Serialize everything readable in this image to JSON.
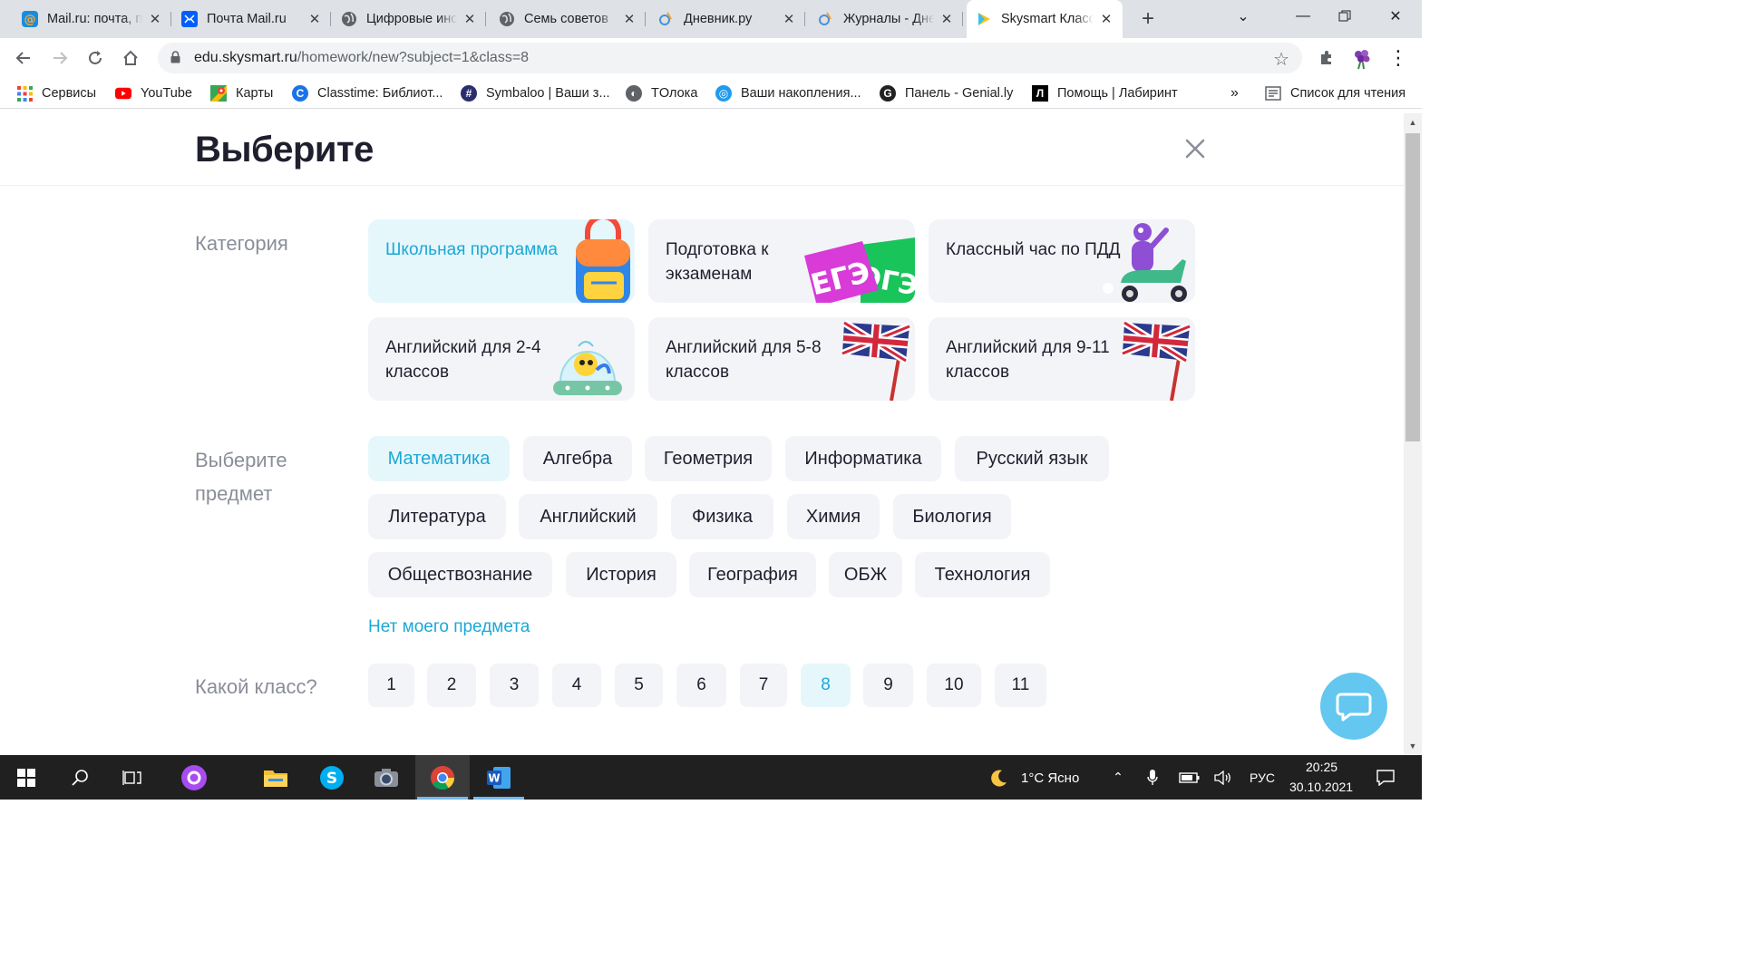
{
  "browser": {
    "tabs": [
      {
        "title": "Mail.ru: почта, поиск",
        "icon": "mailru-at-icon"
      },
      {
        "title": "Почта Mail.ru",
        "icon": "mail-envelope-icon"
      },
      {
        "title": "Цифровые инструменты",
        "icon": "globe-icon"
      },
      {
        "title": "Семь советов",
        "icon": "globe-icon"
      },
      {
        "title": "Дневник.ру",
        "icon": "dnevnik-icon"
      },
      {
        "title": "Журналы - Дневник",
        "icon": "dnevnik-icon"
      },
      {
        "title": "Skysmart Класс",
        "icon": "skysmart-play-icon",
        "active": true
      }
    ],
    "url_host": "edu.skysmart.ru",
    "url_path": "/homework/new?subject=1&class=8",
    "bookmarks": [
      {
        "label": "Сервисы",
        "icon": "apps-grid-icon"
      },
      {
        "label": "YouTube",
        "icon": "youtube-icon"
      },
      {
        "label": "Карты",
        "icon": "maps-icon"
      },
      {
        "label": "Classtime: Библиот...",
        "icon": "classtime-icon"
      },
      {
        "label": "Symbaloo | Ваши з...",
        "icon": "symbaloo-icon"
      },
      {
        "label": "TОлока",
        "icon": "globe-icon"
      },
      {
        "label": "Ваши накопления...",
        "icon": "savings-icon"
      },
      {
        "label": "Панель - Genial.ly",
        "icon": "genially-icon"
      },
      {
        "label": "Помощь | Лабиринт",
        "icon": "labirint-icon"
      }
    ],
    "reading_list": "Список для чтения",
    "overflow": "»"
  },
  "page": {
    "title": "Выберите",
    "category_label": "Категория",
    "categories": [
      {
        "label": "Школьная программа",
        "active": true
      },
      {
        "label": "Подготовка к экзаменам"
      },
      {
        "label": "Классный час по ПДД"
      },
      {
        "label": "Английский для 2-4 классов"
      },
      {
        "label": "Английский для 5-8 классов"
      },
      {
        "label": "Английский для 9-11 классов"
      }
    ],
    "exam_badges": [
      "ЕГЭ",
      "ОГЭ"
    ],
    "subject_label": "Выберите предмет",
    "subjects": [
      {
        "label": "Математика",
        "active": true
      },
      {
        "label": "Алгебра"
      },
      {
        "label": "Геометрия"
      },
      {
        "label": "Информатика"
      },
      {
        "label": "Русский язык"
      },
      {
        "label": "Литература"
      },
      {
        "label": "Английский"
      },
      {
        "label": "Физика"
      },
      {
        "label": "Химия"
      },
      {
        "label": "Биология"
      },
      {
        "label": "Обществознание"
      },
      {
        "label": "История"
      },
      {
        "label": "География"
      },
      {
        "label": "ОБЖ"
      },
      {
        "label": "Технология"
      }
    ],
    "no_subject_link": "Нет моего предмета",
    "grade_label": "Какой класс?",
    "grades": [
      "1",
      "2",
      "3",
      "4",
      "5",
      "6",
      "7",
      "8",
      "9",
      "10",
      "11"
    ],
    "selected_grade": "8"
  },
  "taskbar": {
    "weather": "1°C  Ясно",
    "language": "РУС",
    "time": "20:25",
    "date": "30.10.2021"
  },
  "colors": {
    "accent": "#1ba8d5",
    "active_bg": "#e6f7fc",
    "chip_bg": "#f3f4f7",
    "chat_button": "#63c7f0"
  }
}
